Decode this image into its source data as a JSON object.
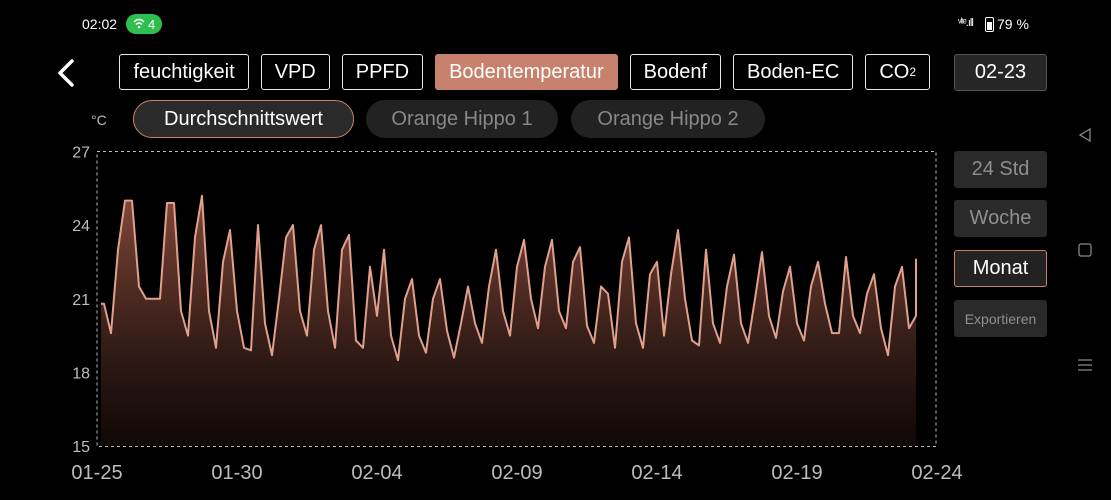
{
  "status": {
    "time": "02:02",
    "wifi_count": "4",
    "signal": "ᵛˡᵗᵉ.ıll",
    "battery": "79 %"
  },
  "tabs": [
    {
      "label": "feuchtigkeit",
      "active": false
    },
    {
      "label": "VPD",
      "active": false
    },
    {
      "label": "PPFD",
      "active": false
    },
    {
      "label": "Bodentemperatur",
      "active": true
    },
    {
      "label": "Bodenf",
      "active": false
    },
    {
      "label": "Boden-EC",
      "active": false
    },
    {
      "label": "CO",
      "sub": "2",
      "active": false
    }
  ],
  "date_button": "02-23",
  "unit": "°C",
  "subtabs": {
    "average": "Durchschnittswert",
    "hippo1": "Orange Hippo 1",
    "hippo2": "Orange Hippo 2"
  },
  "range_buttons": {
    "day": "24 Std",
    "week": "Woche",
    "month": "Monat",
    "export": "Exportieren"
  },
  "colors": {
    "accent": "#c7816d",
    "line": "#e0a08c",
    "fill_top": "#8a4c3d"
  },
  "chart_data": {
    "type": "area",
    "title": "",
    "xlabel": "",
    "ylabel": "°C",
    "ylim": [
      15,
      27
    ],
    "yticks": [
      15,
      18,
      21,
      24,
      27
    ],
    "xlim": [
      "01-25",
      "02-24"
    ],
    "xticks": [
      "01-25",
      "01-30",
      "02-04",
      "02-09",
      "02-14",
      "02-19",
      "02-24"
    ],
    "grid": false,
    "series": [
      {
        "name": "Durchschnittswert",
        "points": [
          [
            "01-25 00:00",
            20.8
          ],
          [
            "01-25 06:00",
            20.8
          ],
          [
            "01-25 12:00",
            19.6
          ],
          [
            "01-25 18:00",
            23.0
          ],
          [
            "01-26 00:00",
            25.0
          ],
          [
            "01-26 06:00",
            25.0
          ],
          [
            "01-26 12:00",
            21.5
          ],
          [
            "01-26 18:00",
            21.0
          ],
          [
            "01-27 00:00",
            21.0
          ],
          [
            "01-27 06:00",
            21.0
          ],
          [
            "01-27 12:00",
            24.9
          ],
          [
            "01-27 18:00",
            24.9
          ],
          [
            "01-28 00:00",
            20.5
          ],
          [
            "01-28 06:00",
            19.5
          ],
          [
            "01-28 12:00",
            23.5
          ],
          [
            "01-28 18:00",
            25.2
          ],
          [
            "01-29 00:00",
            20.5
          ],
          [
            "01-29 06:00",
            19.0
          ],
          [
            "01-29 12:00",
            22.5
          ],
          [
            "01-29 18:00",
            23.8
          ],
          [
            "01-30 00:00",
            20.5
          ],
          [
            "01-30 06:00",
            19.0
          ],
          [
            "01-30 12:00",
            18.9
          ],
          [
            "01-30 18:00",
            24.0
          ],
          [
            "01-31 00:00",
            20.0
          ],
          [
            "01-31 06:00",
            18.7
          ],
          [
            "01-31 12:00",
            21.0
          ],
          [
            "01-31 18:00",
            23.5
          ],
          [
            "02-01 00:00",
            24.0
          ],
          [
            "02-01 06:00",
            20.5
          ],
          [
            "02-01 12:00",
            19.5
          ],
          [
            "02-01 18:00",
            23.0
          ],
          [
            "02-02 00:00",
            24.0
          ],
          [
            "02-02 06:00",
            20.5
          ],
          [
            "02-02 12:00",
            19.0
          ],
          [
            "02-02 18:00",
            23.0
          ],
          [
            "02-03 00:00",
            23.6
          ],
          [
            "02-03 06:00",
            19.3
          ],
          [
            "02-03 12:00",
            19.0
          ],
          [
            "02-03 18:00",
            22.3
          ],
          [
            "02-04 00:00",
            20.3
          ],
          [
            "02-04 06:00",
            23.0
          ],
          [
            "02-04 12:00",
            19.5
          ],
          [
            "02-04 18:00",
            18.5
          ],
          [
            "02-05 00:00",
            21.0
          ],
          [
            "02-05 06:00",
            21.8
          ],
          [
            "02-05 12:00",
            19.5
          ],
          [
            "02-05 18:00",
            18.8
          ],
          [
            "02-06 00:00",
            21.0
          ],
          [
            "02-06 06:00",
            21.8
          ],
          [
            "02-06 12:00",
            19.7
          ],
          [
            "02-06 18:00",
            18.6
          ],
          [
            "02-07 00:00",
            20.0
          ],
          [
            "02-07 06:00",
            21.5
          ],
          [
            "02-07 12:00",
            20.0
          ],
          [
            "02-07 18:00",
            19.2
          ],
          [
            "02-08 00:00",
            21.5
          ],
          [
            "02-08 06:00",
            23.0
          ],
          [
            "02-08 12:00",
            20.5
          ],
          [
            "02-08 18:00",
            19.5
          ],
          [
            "02-09 00:00",
            22.3
          ],
          [
            "02-09 06:00",
            23.4
          ],
          [
            "02-09 12:00",
            21.0
          ],
          [
            "02-09 18:00",
            19.8
          ],
          [
            "02-10 00:00",
            22.3
          ],
          [
            "02-10 06:00",
            23.4
          ],
          [
            "02-10 12:00",
            20.5
          ],
          [
            "02-10 18:00",
            19.8
          ],
          [
            "02-11 00:00",
            22.5
          ],
          [
            "02-11 06:00",
            23.1
          ],
          [
            "02-11 12:00",
            19.9
          ],
          [
            "02-11 18:00",
            19.2
          ],
          [
            "02-12 00:00",
            21.5
          ],
          [
            "02-12 06:00",
            21.2
          ],
          [
            "02-12 12:00",
            19.0
          ],
          [
            "02-12 18:00",
            22.5
          ],
          [
            "02-13 00:00",
            23.5
          ],
          [
            "02-13 06:00",
            20.0
          ],
          [
            "02-13 12:00",
            19.0
          ],
          [
            "02-13 18:00",
            22.0
          ],
          [
            "02-14 00:00",
            22.5
          ],
          [
            "02-14 06:00",
            19.5
          ],
          [
            "02-14 12:00",
            22.0
          ],
          [
            "02-14 18:00",
            23.8
          ],
          [
            "02-15 00:00",
            21.0
          ],
          [
            "02-15 06:00",
            19.3
          ],
          [
            "02-15 12:00",
            19.1
          ],
          [
            "02-15 18:00",
            23.0
          ],
          [
            "02-16 00:00",
            20.0
          ],
          [
            "02-16 06:00",
            19.2
          ],
          [
            "02-16 12:00",
            21.5
          ],
          [
            "02-16 18:00",
            22.8
          ],
          [
            "02-17 00:00",
            20.0
          ],
          [
            "02-17 06:00",
            19.2
          ],
          [
            "02-17 12:00",
            21.0
          ],
          [
            "02-17 18:00",
            22.9
          ],
          [
            "02-18 00:00",
            20.3
          ],
          [
            "02-18 06:00",
            19.4
          ],
          [
            "02-18 12:00",
            21.3
          ],
          [
            "02-18 18:00",
            22.3
          ],
          [
            "02-19 00:00",
            20.0
          ],
          [
            "02-19 06:00",
            19.3
          ],
          [
            "02-19 12:00",
            21.5
          ],
          [
            "02-19 18:00",
            22.5
          ],
          [
            "02-20 00:00",
            20.8
          ],
          [
            "02-20 06:00",
            19.6
          ],
          [
            "02-20 12:00",
            19.6
          ],
          [
            "02-20 18:00",
            22.7
          ],
          [
            "02-21 00:00",
            20.3
          ],
          [
            "02-21 06:00",
            19.6
          ],
          [
            "02-21 12:00",
            21.2
          ],
          [
            "02-21 18:00",
            22.0
          ],
          [
            "02-22 00:00",
            19.8
          ],
          [
            "02-22 06:00",
            18.7
          ],
          [
            "02-22 12:00",
            21.5
          ],
          [
            "02-22 18:00",
            22.3
          ],
          [
            "02-23 00:00",
            19.8
          ],
          [
            "02-23 06:00",
            20.3
          ],
          [
            "02-23 12:00",
            22.6
          ],
          [
            "02-23 18:00",
            22.6
          ],
          [
            "02-24 00:00",
            21.1
          ]
        ]
      }
    ]
  }
}
